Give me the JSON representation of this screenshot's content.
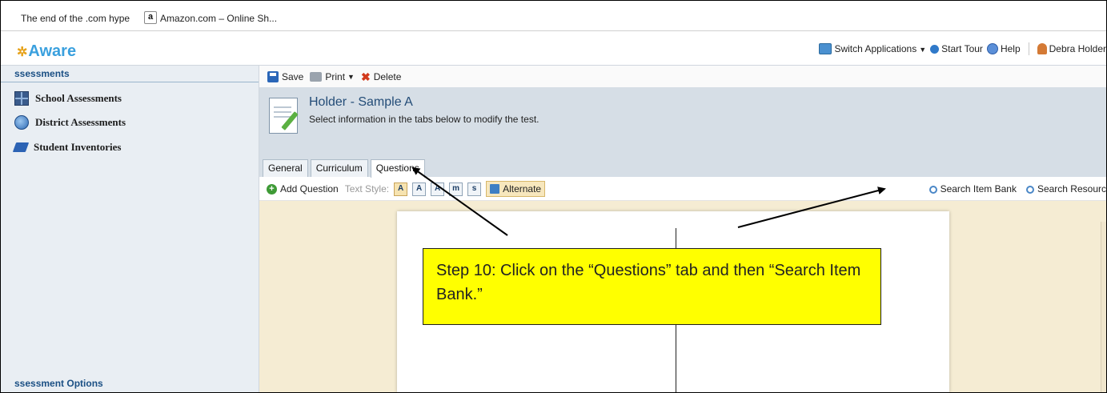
{
  "favorites": {
    "item1": "The end of the .com hype",
    "item2_icon": "a",
    "item2": "Amazon.com – Online Sh..."
  },
  "app": {
    "logo": "Aware",
    "topnav": {
      "switch": "Switch Applications",
      "tour": "Start Tour",
      "help": "Help",
      "user": "Debra Holder"
    }
  },
  "sidebar": {
    "header": "ssessments",
    "items": [
      {
        "label": "School Assessments"
      },
      {
        "label": "District Assessments"
      },
      {
        "label": "Student Inventories"
      }
    ],
    "footer": "ssessment Options"
  },
  "toolbar": {
    "save": "Save",
    "print": "Print",
    "delete": "Delete"
  },
  "header": {
    "title": "Holder - Sample A",
    "subtitle": "Select information in the tabs below to modify the test."
  },
  "tabs": [
    {
      "label": "General"
    },
    {
      "label": "Curriculum"
    },
    {
      "label": "Questions",
      "active": true
    }
  ],
  "question_bar": {
    "add": "Add Question",
    "text_style_label": "Text Style:",
    "style_buttons": [
      "A",
      "A",
      "A",
      "m",
      "s"
    ],
    "alternate": "Alternate",
    "search_item_bank": "Search Item Bank",
    "search_resources": "Search Resourc"
  },
  "callout": {
    "text": "Step 10: Click on the “Questions” tab and then “Search Item Bank.”"
  },
  "colors": {
    "callout_bg": "#ffff00",
    "canvas_bg": "#f5ecd3",
    "header_bg": "#d6dee6",
    "accent": "#3aa0de"
  }
}
